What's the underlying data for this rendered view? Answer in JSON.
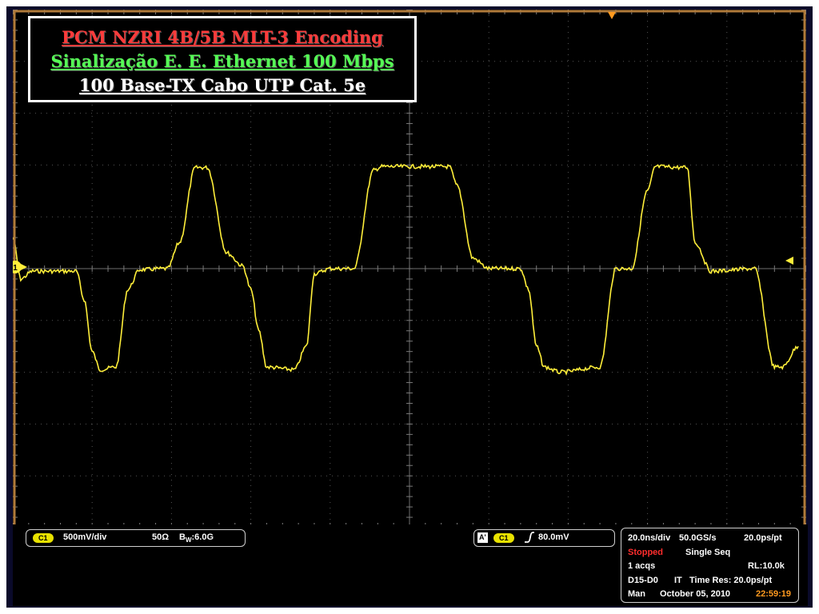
{
  "title_box": {
    "line1": "PCM NZRI 4B/5B  MLT-3 Encoding",
    "line2": "Sinalização E. E. Ethernet 100 Mbps",
    "line3": "100 Base-TX  Cabo UTP Cat. 5e"
  },
  "colors": {
    "waveform": "#ffef3a",
    "grid": "#7a7a7a",
    "border": "#b07a3a",
    "trigger_marker": "#ff9a1f",
    "background": "#000000"
  },
  "channel": {
    "badge": "C1",
    "scale": "500mV/div",
    "impedance": "50Ω",
    "bandwidth_prefix": "B",
    "bandwidth_sub": "W",
    "bandwidth": ":6.0G"
  },
  "trigger": {
    "mode_badge": "A'",
    "source_badge": "C1",
    "slope_icon": "rising-edge-icon",
    "level": "80.0mV"
  },
  "acquisition": {
    "timebase": "20.0ns/div",
    "sample_rate": "50.0GS/s",
    "resolution_pt": "20.0ps/pt",
    "status": "Stopped",
    "mode": "Single Seq",
    "acqs": "1 acqs",
    "record_length": "RL:10.0k",
    "digital": "D15-D0",
    "it_label": "IT",
    "time_res": "Time Res: 20.0ps/pt",
    "man": "Man",
    "date": "October 05, 2010",
    "time": "22:59:19"
  },
  "markers": {
    "channel_ref": "1"
  },
  "chart_data": {
    "type": "line",
    "title": "",
    "xlabel": "",
    "ylabel": "",
    "x_divisions": 10,
    "y_divisions": 10,
    "xlim_div": [
      0,
      10
    ],
    "ylim_div": [
      -5,
      5
    ],
    "grid": true,
    "series": [
      {
        "x": [
          0.0,
          0.1,
          0.25,
          0.8,
          0.9,
          1.0,
          1.1,
          1.3,
          1.45,
          1.6,
          1.95,
          2.1,
          2.3,
          2.45,
          2.7,
          2.9,
          3.0,
          3.1,
          3.2,
          3.55,
          3.7,
          3.8,
          4.0,
          4.3,
          4.55,
          4.65,
          5.5,
          5.6,
          5.8,
          6.0,
          6.4,
          6.5,
          6.6,
          6.7,
          6.9,
          7.4,
          7.6,
          7.8,
          8.0,
          8.1,
          8.5,
          8.6,
          8.8,
          9.35,
          9.6,
          9.7,
          9.9
        ],
        "y": [
          0.6,
          -0.2,
          -0.05,
          -0.05,
          -0.6,
          -1.6,
          -1.95,
          -1.9,
          -0.4,
          -0.02,
          0.0,
          0.5,
          1.95,
          1.95,
          0.3,
          0.05,
          -0.4,
          -1.2,
          -1.9,
          -1.95,
          -1.5,
          -0.1,
          0.0,
          0.0,
          1.9,
          1.97,
          1.97,
          1.6,
          0.2,
          0.0,
          0.0,
          -0.4,
          -1.5,
          -1.9,
          -2.0,
          -1.9,
          0.0,
          0.0,
          1.5,
          1.97,
          1.95,
          0.5,
          -0.05,
          0.0,
          -1.9,
          -1.9,
          -1.5
        ]
      }
    ]
  }
}
